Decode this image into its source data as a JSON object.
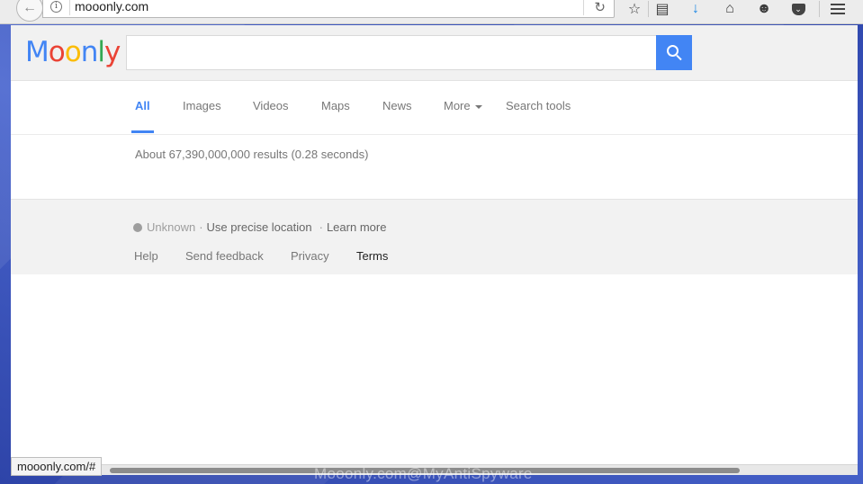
{
  "browser": {
    "url": "mooonly.com",
    "toolbar_icons": [
      "bookmark-star-icon",
      "reading-list-icon",
      "download-arrow-icon",
      "home-icon",
      "chat-icon",
      "pocket-icon",
      "menu-icon"
    ]
  },
  "header": {
    "logo_letters": [
      "M",
      "o",
      "o",
      "n",
      "l",
      "y"
    ],
    "search_placeholder": ""
  },
  "tabs": [
    "All",
    "Images",
    "Videos",
    "Maps",
    "News",
    "More",
    "Search tools"
  ],
  "results": {
    "count_text": "About 67,390,000,000 results (0.28 seconds)"
  },
  "footer": {
    "location_status": "Unknown",
    "precise_location": "Use precise location",
    "learn_more": "Learn more",
    "links": [
      "Help",
      "Send feedback",
      "Privacy",
      "Terms"
    ]
  },
  "status_bar": {
    "hover_url": "mooonly.com/#"
  },
  "watermark": "Mooonly.com@MyAntiSpyware",
  "colors": {
    "accent_blue": "#4285f4",
    "footer_bg": "#f2f2f2",
    "desktop_blue": "#3a53b8"
  }
}
